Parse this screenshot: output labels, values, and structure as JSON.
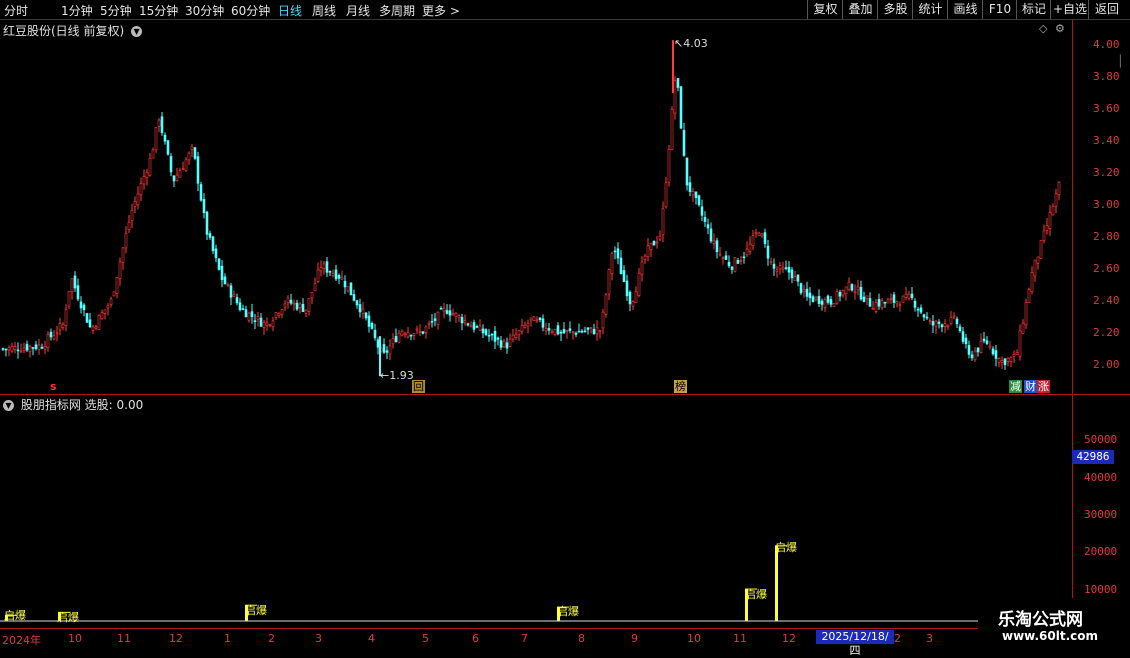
{
  "toolbar": {
    "periods": [
      "分时",
      "1分钟",
      "5分钟",
      "15分钟",
      "30分钟",
      "60分钟",
      "日线",
      "周线",
      "月线",
      "多周期",
      "更多 >"
    ],
    "active": "日线",
    "actions": [
      "复权",
      "叠加",
      "多股",
      "统计",
      "画线",
      "F10",
      "标记",
      "+自选",
      "返回"
    ]
  },
  "main": {
    "title": "红豆股份(日线 前复权)",
    "high_label": "4.03",
    "low_label": "1.93",
    "y_ticks": [
      "4.00",
      "3.80",
      "3.60",
      "3.40",
      "3.20",
      "3.00",
      "2.80",
      "2.60",
      "2.40",
      "2.20",
      "2.00"
    ],
    "badges": {
      "s": "s",
      "hui": "回",
      "bang": "榜",
      "jian": "减",
      "cai": "财",
      "zhang": "涨"
    }
  },
  "indicator": {
    "title": "股朋指标网 选股: 0.00",
    "y_ticks": [
      "50000",
      "40000",
      "30000",
      "20000",
      "10000"
    ],
    "current_value": "42986",
    "signal_label": "启爆"
  },
  "date_axis": {
    "labels": [
      "2024年",
      "10",
      "11",
      "12",
      "1",
      "2",
      "3",
      "4",
      "5",
      "6",
      "7",
      "8",
      "9",
      "10",
      "11",
      "12",
      "2",
      "3"
    ],
    "cursor": "2025/12/18/四"
  },
  "watermark": {
    "title": "乐淘公式网",
    "url": "www.60lt.com"
  },
  "colors": {
    "up": "#ff3b3b",
    "down": "#54ffff",
    "signal": "#ffff33",
    "grid": "#b0141b"
  }
}
